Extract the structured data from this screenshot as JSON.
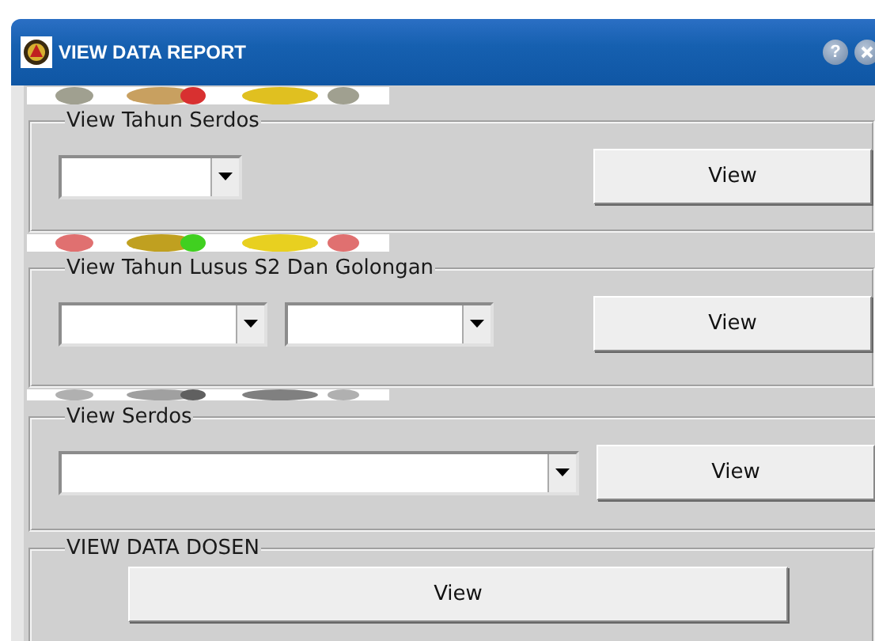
{
  "window": {
    "title": "VIEW DATA REPORT",
    "help": "?"
  },
  "sections": [
    {
      "label": "View Tahun Serdos",
      "banner": {
        "kind": "picture"
      },
      "dropdowns": [
        {
          "kind": "short"
        }
      ],
      "button": {
        "label": "View",
        "kind": "side"
      }
    },
    {
      "label": "View Tahun Lusus S2 Dan Golongan",
      "banner": {
        "kind": "picture"
      },
      "dropdowns": [
        {
          "kind": "medium"
        },
        {
          "kind": "medium"
        }
      ],
      "button": {
        "label": "View",
        "kind": "side"
      }
    },
    {
      "label": "View Serdos",
      "banner": {
        "kind": "picture"
      },
      "dropdowns": [
        {
          "kind": "long"
        }
      ],
      "button": {
        "label": "View",
        "kind": "side"
      }
    },
    {
      "label": "VIEW DATA DOSEN",
      "button": {
        "label": "View",
        "kind": "wide"
      }
    }
  ]
}
